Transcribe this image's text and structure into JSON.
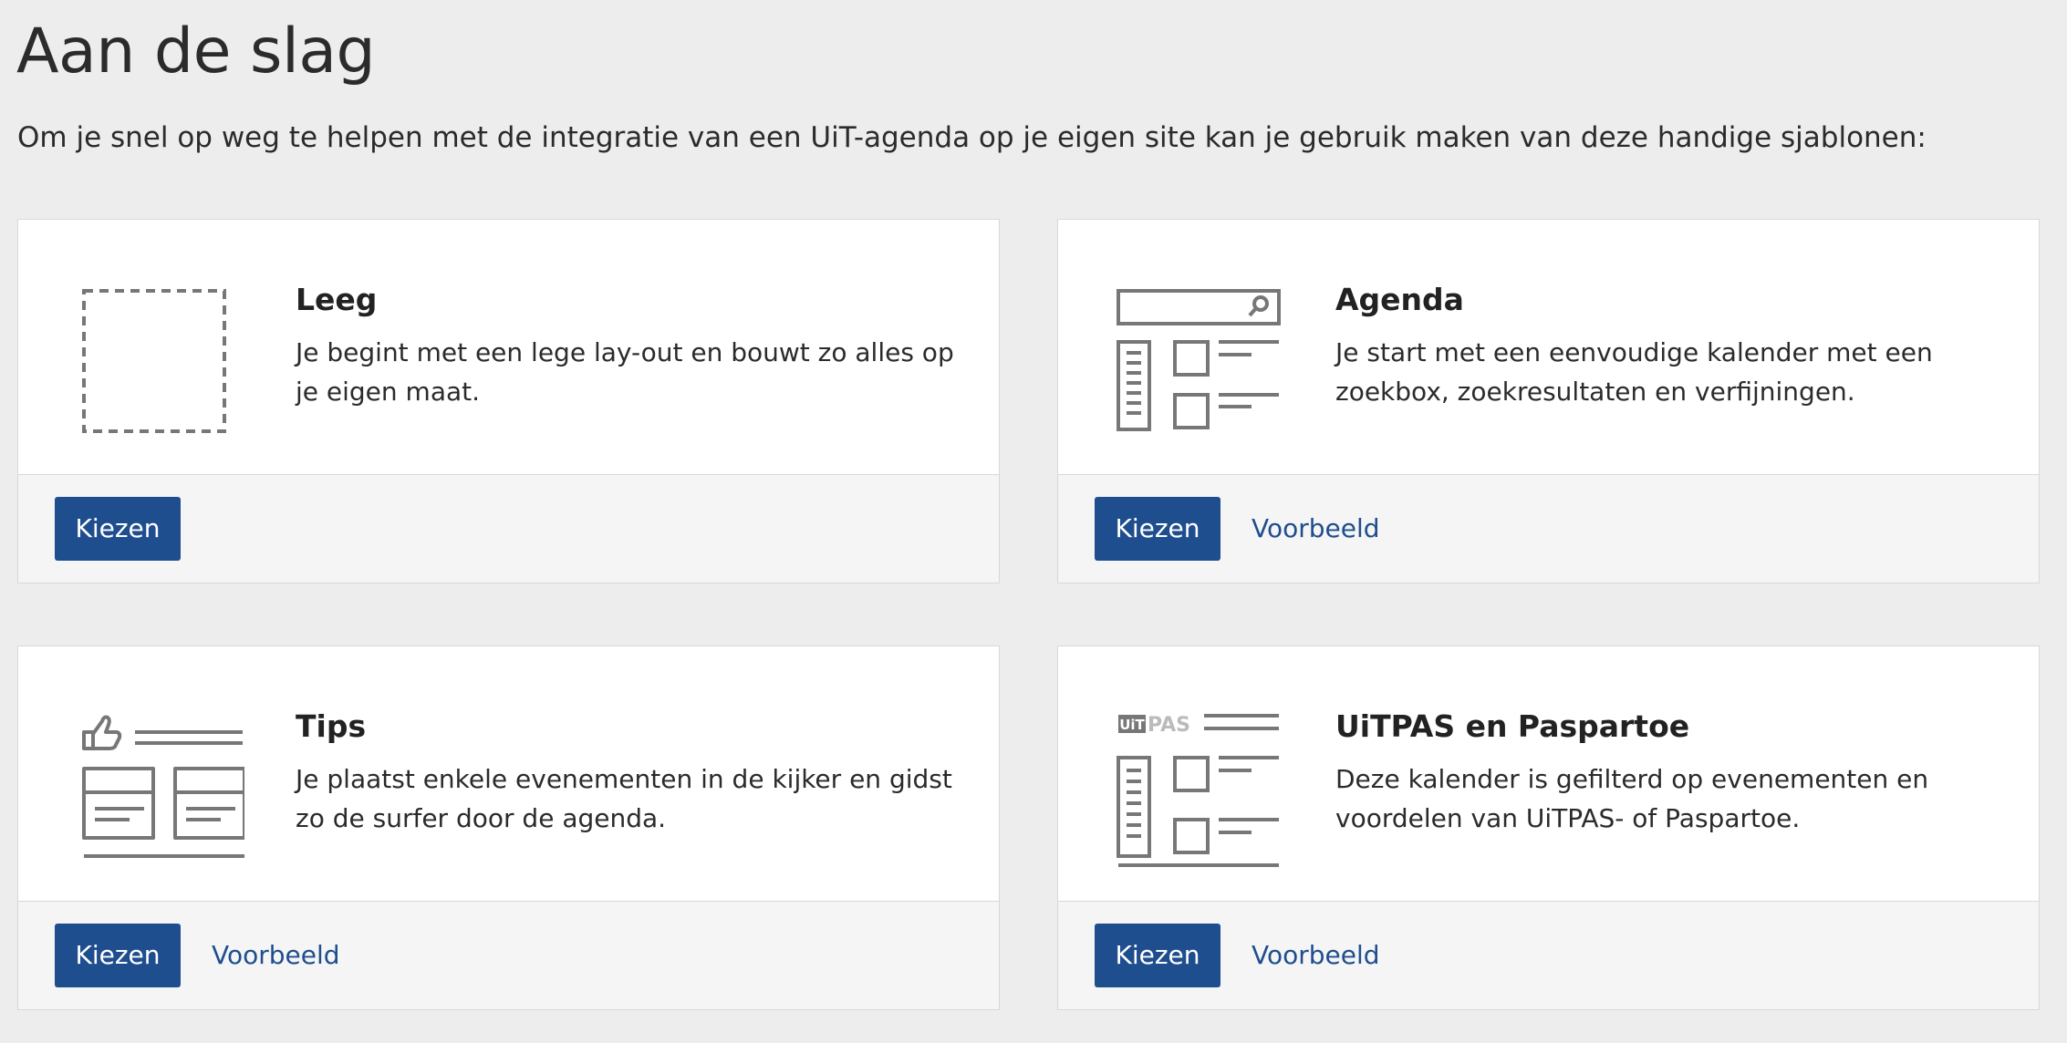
{
  "page": {
    "title": "Aan de slag",
    "intro": "Om je snel op weg te helpen met de integratie van een UiT-agenda op je eigen site kan je gebruik maken van deze handige sjablonen:"
  },
  "cards": [
    {
      "title": "Leeg",
      "description": "Je begint met een lege lay-out en bouwt zo alles op je eigen maat.",
      "choose_label": "Kiezen",
      "icon": "empty-layout-icon"
    },
    {
      "title": "Agenda",
      "description": "Je start met een eenvoudige kalender met een zoekbox, zoekresultaten en verfijningen.",
      "choose_label": "Kiezen",
      "example_label": "Voorbeeld",
      "icon": "agenda-layout-icon"
    },
    {
      "title": "Tips",
      "description": "Je plaatst enkele evenementen in de kijker en gidst zo de surfer door de agenda.",
      "choose_label": "Kiezen",
      "example_label": "Voorbeeld",
      "icon": "tips-layout-icon"
    },
    {
      "title": "UiTPAS en Paspartoe",
      "description": "Deze kalender is gefilterd op evenementen en voordelen van UiTPAS- of Paspartoe.",
      "choose_label": "Kiezen",
      "example_label": "Voorbeeld",
      "icon": "uitpas-layout-icon",
      "icon_text_uit": "UiT",
      "icon_text_pas": "PAS"
    }
  ],
  "colors": {
    "primary": "#1f4e8f",
    "background": "#ededed",
    "card": "#ffffff",
    "footer": "#f5f5f5",
    "icon": "#777777"
  }
}
